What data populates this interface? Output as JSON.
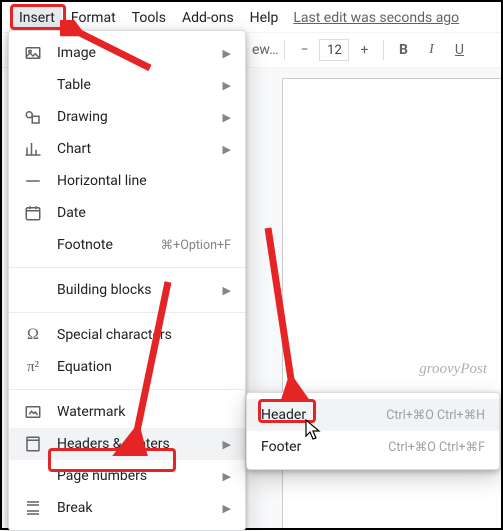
{
  "menubar": {
    "items": [
      {
        "label": "Insert",
        "open": true
      },
      {
        "label": "Format"
      },
      {
        "label": "Tools"
      },
      {
        "label": "Add-ons"
      },
      {
        "label": "Help"
      }
    ],
    "edit_status": "Last edit was seconds ago"
  },
  "toolbar": {
    "style_truncated": "ew…",
    "font_size": "12",
    "bold": "B",
    "italic": "I",
    "underline": "U"
  },
  "dropdown": {
    "items": [
      {
        "icon": "image-icon",
        "label": "Image",
        "submenu": true
      },
      {
        "icon": "table-icon",
        "label": "Table",
        "submenu": true
      },
      {
        "icon": "drawing-icon",
        "label": "Drawing",
        "submenu": true
      },
      {
        "icon": "chart-icon",
        "label": "Chart",
        "submenu": true
      },
      {
        "icon": "hr-icon",
        "label": "Horizontal line"
      },
      {
        "icon": "date-icon",
        "label": "Date"
      },
      {
        "icon": "footnote-icon",
        "label": "Footnote",
        "shortcut": "⌘+Option+F"
      },
      {
        "divider": true
      },
      {
        "icon": "blocks-icon",
        "label": "Building blocks",
        "submenu": true
      },
      {
        "divider": true
      },
      {
        "icon": "omega-icon",
        "label": "Special characters"
      },
      {
        "icon": "pi-icon",
        "label": "Equation"
      },
      {
        "divider": true
      },
      {
        "icon": "watermark-icon",
        "label": "Watermark"
      },
      {
        "icon": "headers-icon",
        "label": "Headers & footers",
        "submenu": true,
        "highlight": true
      },
      {
        "icon": "pagenum-icon",
        "label": "Page numbers",
        "submenu": true
      },
      {
        "icon": "break-icon",
        "label": "Break",
        "submenu": true
      }
    ]
  },
  "submenu": {
    "items": [
      {
        "label": "Header",
        "shortcut": "Ctrl+⌘O Ctrl+⌘H",
        "highlight": true
      },
      {
        "label": "Footer",
        "shortcut": "Ctrl+⌘O Ctrl+⌘F"
      }
    ]
  },
  "watermark": "groovyPost"
}
